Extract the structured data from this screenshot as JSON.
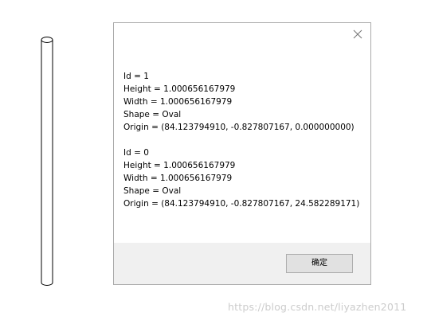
{
  "dialog": {
    "records": [
      {
        "id_line": "Id = 1",
        "height_line": "Height = 1.000656167979",
        "width_line": "Width = 1.000656167979",
        "shape_line": "Shape = Oval",
        "origin_line": "Origin = (84.123794910, -0.827807167, 0.000000000)"
      },
      {
        "id_line": "Id = 0",
        "height_line": "Height = 1.000656167979",
        "width_line": "Width = 1.000656167979",
        "shape_line": "Shape = Oval",
        "origin_line": "Origin = (84.123794910, -0.827807167, 24.582289171)"
      }
    ],
    "ok_label": "确定",
    "close_icon": "close-icon"
  },
  "watermark": "https://blog.csdn.net/liyazhen2011",
  "colors": {
    "dialog_border": "#aaaaaa",
    "footer_bg": "#f0f0f0",
    "button_bg": "#e1e1e1",
    "button_border": "#adadad"
  }
}
